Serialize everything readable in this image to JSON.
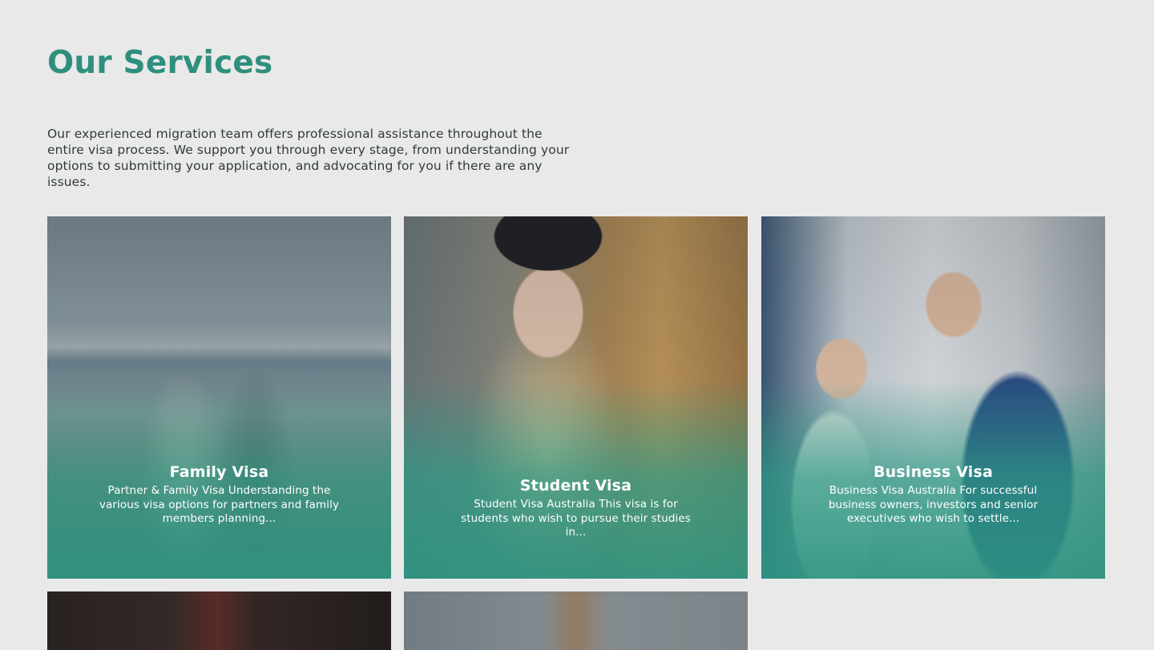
{
  "section": {
    "title": "Our Services",
    "intro": "Our experienced migration team offers professional assistance throughout the entire visa process. We support you through every stage, from understanding your options to submitting your application, and advocating for you if there are any issues."
  },
  "cards": [
    {
      "title": "Family Visa",
      "description": "Partner & Family Visa Understanding the various visa options for partners and family members planning..."
    },
    {
      "title": "Student Visa",
      "description": "Student Visa Australia This visa is for students who wish to pursue their studies in..."
    },
    {
      "title": "Business Visa",
      "description": "Business Visa Australia For successful business owners, investors and senior executives who wish to settle..."
    }
  ],
  "colors": {
    "accent": "#2e8f7d",
    "background": "#e9e9e9",
    "card_overlay": "#2c9380"
  }
}
